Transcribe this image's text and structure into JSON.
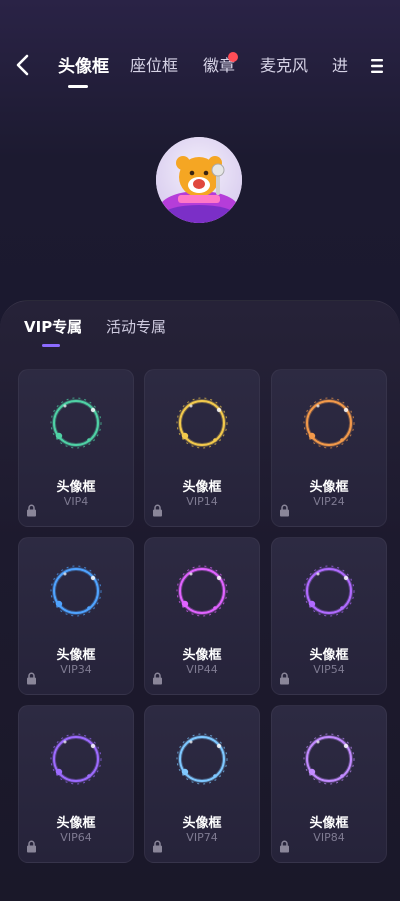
{
  "header": {
    "tabs": [
      {
        "label": "头像框"
      },
      {
        "label": "座位框"
      },
      {
        "label": "徽章"
      },
      {
        "label": "麦克风"
      },
      {
        "label": "进"
      }
    ]
  },
  "sub_tabs": [
    "VIP专属",
    "活动专属"
  ],
  "cards": [
    {
      "name": "头像框",
      "vip": "VIP4",
      "color": "#4fd1a5"
    },
    {
      "name": "头像框",
      "vip": "VIP14",
      "color": "#f2c94c"
    },
    {
      "name": "头像框",
      "vip": "VIP24",
      "color": "#f2994a"
    },
    {
      "name": "头像框",
      "vip": "VIP34",
      "color": "#4fa3ff"
    },
    {
      "name": "头像框",
      "vip": "VIP44",
      "color": "#e063ff"
    },
    {
      "name": "头像框",
      "vip": "VIP54",
      "color": "#b06bff"
    },
    {
      "name": "头像框",
      "vip": "VIP64",
      "color": "#9d6bff"
    },
    {
      "name": "头像框",
      "vip": "VIP74",
      "color": "#7fc8ff"
    },
    {
      "name": "头像框",
      "vip": "VIP84",
      "color": "#c28bff"
    }
  ],
  "colors": {
    "accent": "#8c6bff",
    "badge": "#ff4d57"
  }
}
